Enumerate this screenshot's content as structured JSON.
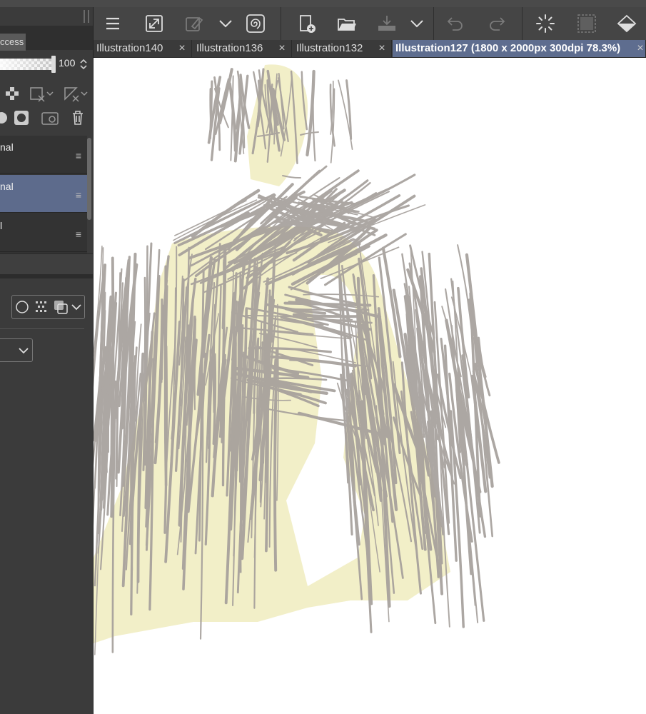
{
  "left_panel": {
    "tab_label": "ccess",
    "opacity_value": "100",
    "layers": [
      {
        "name": "nal",
        "selected": false
      },
      {
        "name": "nal",
        "selected": true
      },
      {
        "name": "l",
        "selected": false
      }
    ],
    "layer_menu_glyph": "≡"
  },
  "toolbar": {
    "items": [
      "menu-icon",
      "zoom-fit-icon",
      "eyedropper-icon",
      "chevron-down-icon",
      "spiral-icon",
      "new-file-icon",
      "open-folder-icon",
      "save-icon",
      "chevron-down-icon",
      "undo-icon",
      "redo-icon",
      "loading-icon",
      "selection-icon",
      "fill-icon"
    ]
  },
  "tabs": [
    {
      "label": "Illustration140",
      "active": false
    },
    {
      "label": "Illustration136",
      "active": false
    },
    {
      "label": "Illustration132",
      "active": false
    },
    {
      "label": "Illustration127 (1800 x 2000px 300dpi 78.3%)",
      "active": true
    }
  ],
  "tab_close_glyph": "×",
  "colors": {
    "accent": "#5e6d8f",
    "sketch_gray": "#a49e9a",
    "sketch_yellow": "#f2efc8"
  }
}
